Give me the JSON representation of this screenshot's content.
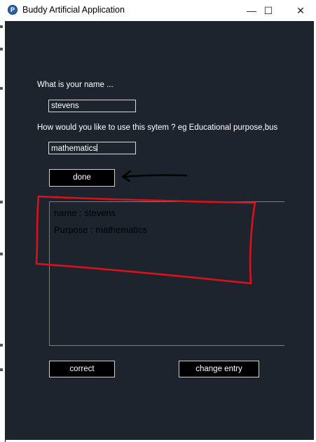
{
  "window": {
    "title": "Buddy Artificial Application",
    "app_icon": "python-feather-icon",
    "controls": {
      "minimize": "—",
      "maximize": "☐",
      "close": "✕"
    }
  },
  "form": {
    "name_label": "What is your name ...",
    "name_value": "stevens",
    "purpose_label": "How would you like to use this sytem ? eg Educational purpose,bus",
    "purpose_value": "mathematics",
    "done_label": "done"
  },
  "output": {
    "lines": [
      "name : stevens",
      "Purpose : mathematics"
    ]
  },
  "footer": {
    "correct_label": "correct",
    "change_label": "change entry"
  },
  "annotations": {
    "arrow_color": "#000000",
    "box_color": "#e0101a"
  },
  "colors": {
    "background": "#1e242e",
    "text": "#ffffff",
    "button_bg": "#000000"
  }
}
